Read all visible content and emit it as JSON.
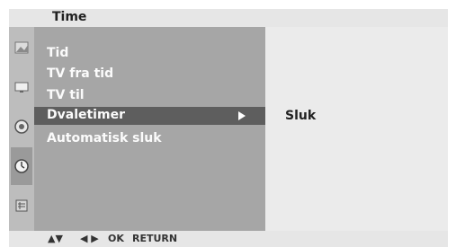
{
  "header": {
    "title": "Time"
  },
  "menu": {
    "items": [
      {
        "label": "Tid"
      },
      {
        "label": "TV fra tid"
      },
      {
        "label": "TV til"
      },
      {
        "label": "Dvaletimer",
        "selected": true
      },
      {
        "label": "Automatisk sluk"
      }
    ],
    "selected_value": "Sluk"
  },
  "footer": {
    "up_down": "▲▼",
    "left_right": "◀ ▶",
    "ok": "OK",
    "return": "RETURN"
  },
  "icons": [
    "picture-icon",
    "screen-icon",
    "audio-icon",
    "clock-icon",
    "setup-icon"
  ]
}
